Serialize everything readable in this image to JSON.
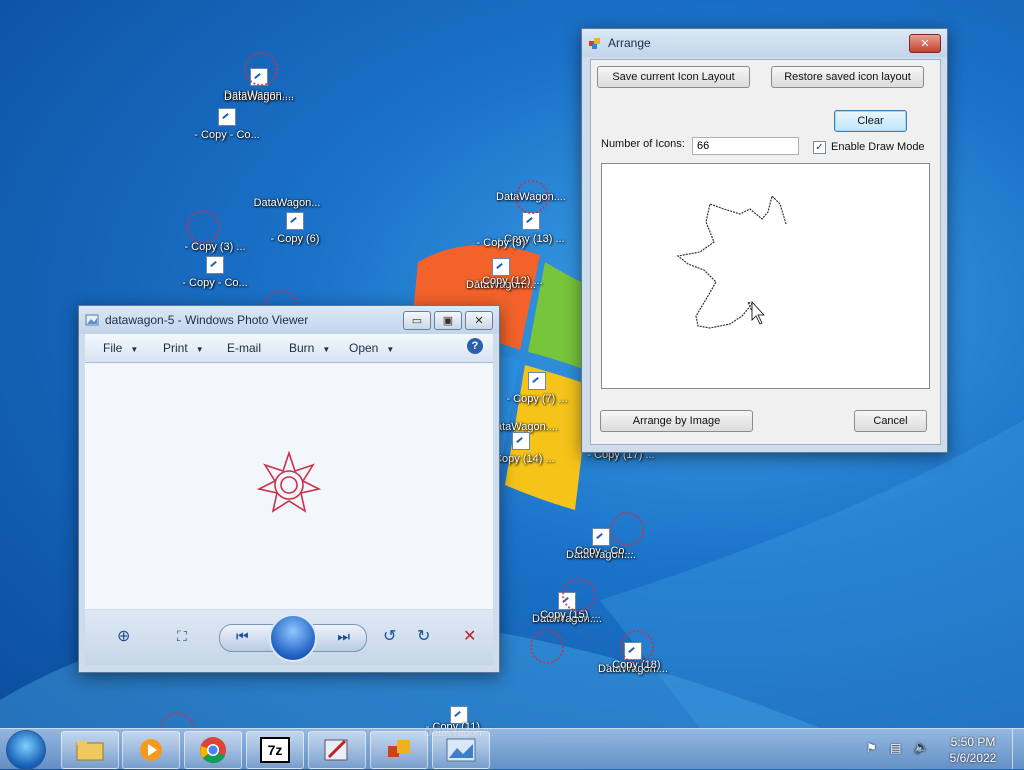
{
  "desktop": {
    "icons": [
      {
        "label": "DataWagon....",
        "x": 0,
        "y": 0
      },
      {
        "label": "DataWagon....",
        "x": 0,
        "y": 0
      },
      {
        "label": "- Copy - Co...",
        "x": 0,
        "y": 0
      },
      {
        "label": "DataWagon...",
        "x": 0,
        "y": 0
      },
      {
        "label": "- Copy (6)",
        "x": 0,
        "y": 0
      },
      {
        "label": "- Copy (3) ...",
        "x": 0,
        "y": 0
      },
      {
        "label": "- Copy - Co...",
        "x": 0,
        "y": 0
      },
      {
        "label": "DataWagon....",
        "x": 0,
        "y": 0
      },
      {
        "label": "- Copy (13) ...",
        "x": 0,
        "y": 0
      },
      {
        "label": "- Copy (9)",
        "x": 0,
        "y": 0
      },
      {
        "label": "DataWagon....",
        "x": 0,
        "y": 0
      },
      {
        "label": "- Copy (12) ...",
        "x": 0,
        "y": 0
      },
      {
        "label": "- Copy (7) ...",
        "x": 0,
        "y": 0
      },
      {
        "label": "DataWagon....",
        "x": 0,
        "y": 0
      },
      {
        "label": "- Copy (14) ...",
        "x": 0,
        "y": 0
      },
      {
        "label": "- Copy (17) ...",
        "x": 0,
        "y": 0
      },
      {
        "label": "DataWagon....",
        "x": 0,
        "y": 0
      },
      {
        "label": "- Copy - Co...",
        "x": 0,
        "y": 0
      },
      {
        "label": "DataWagon....",
        "x": 0,
        "y": 0
      },
      {
        "label": "- Copy (15) ...",
        "x": 0,
        "y": 0
      },
      {
        "label": "DataWagon....",
        "x": 0,
        "y": 0
      },
      {
        "label": "- Copy (18)",
        "x": 0,
        "y": 0
      },
      {
        "label": "DataWagon....",
        "x": 0,
        "y": 0
      },
      {
        "label": "- Copy (11) ...",
        "x": 0,
        "y": 0
      }
    ]
  },
  "arrange": {
    "title": "Arrange",
    "close_label": "✕",
    "save_layout_label": "Save current Icon Layout",
    "restore_layout_label": "Restore saved icon layout",
    "clear_label": "Clear",
    "num_icons_label": "Number of Icons:",
    "num_icons_value": "66",
    "draw_mode_label": "Enable Draw Mode",
    "draw_mode_checked": true,
    "arrange_by_image_label": "Arrange by Image",
    "cancel_label": "Cancel"
  },
  "photo_viewer": {
    "title": "datawagon-5 - Windows Photo Viewer",
    "menu": [
      "File",
      "Print",
      "E-mail",
      "Burn",
      "Open"
    ],
    "help_label": "?",
    "min_label": "▭",
    "max_label": "▣",
    "close_label": "✕"
  },
  "taskbar": {
    "clock_time": "5:50 PM",
    "clock_date": "5/6/2022",
    "pinned": [
      "folder-icon",
      "media-player-icon",
      "chrome-icon",
      "7zip-icon",
      "paint-icon",
      "arrange-app-icon",
      "photo-viewer-icon"
    ],
    "tray_icons": [
      "action-center-icon",
      "network-icon",
      "volume-icon"
    ]
  },
  "colors": {
    "desktop_blue": "#1b73c9",
    "flower_red": "#c8324a"
  }
}
